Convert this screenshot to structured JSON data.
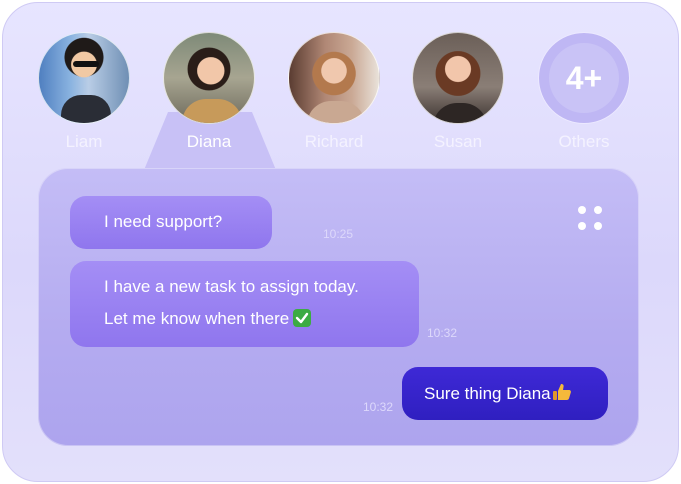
{
  "contacts": [
    {
      "name": "Liam",
      "icon": "avatar-photo"
    },
    {
      "name": "Diana",
      "icon": "avatar-photo",
      "active": true
    },
    {
      "name": "Richard",
      "icon": "avatar-photo"
    },
    {
      "name": "Susan",
      "icon": "avatar-photo"
    }
  ],
  "others": {
    "count": "4+",
    "label": "Others"
  },
  "messages": [
    {
      "text": "I need support?",
      "time": "10:25",
      "direction": "incoming"
    },
    {
      "lines": [
        "I have a new task to assign today.",
        "Let me know when there"
      ],
      "emoji": "check-mark-icon",
      "time": "10:32",
      "direction": "incoming"
    },
    {
      "text": "Sure thing Diana",
      "emoji": "thumbs-up-icon",
      "time": "10:32",
      "direction": "outgoing"
    }
  ],
  "colors": {
    "card_bg": "#e3e0fb",
    "panel_bg": "#b4abf0",
    "incoming_bubble": "#9a83f2",
    "outgoing_bubble": "#3624cc",
    "check_green": "#3cab43"
  }
}
